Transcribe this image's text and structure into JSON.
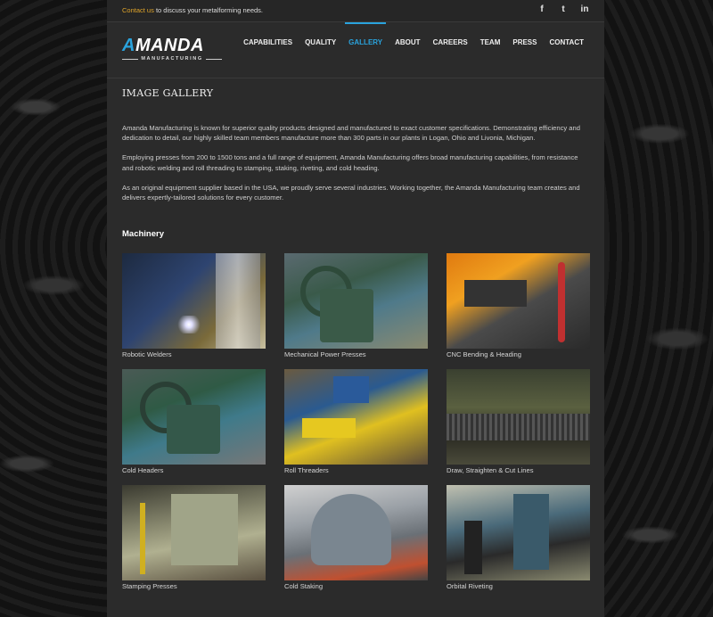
{
  "topbar": {
    "contact_link": "Contact us",
    "contact_rest": " to discuss your metalforming needs.",
    "social": [
      {
        "icon": "facebook-icon",
        "glyph": "f"
      },
      {
        "icon": "twitter-icon",
        "glyph": "t"
      },
      {
        "icon": "linkedin-icon",
        "glyph": "in"
      }
    ]
  },
  "logo": {
    "word_first": "A",
    "word_rest": "MANDA",
    "sub": "MANUFACTURING"
  },
  "nav": [
    "CAPABILITIES",
    "QUALITY",
    "GALLERY",
    "ABOUT",
    "CAREERS",
    "TEAM",
    "PRESS",
    "CONTACT"
  ],
  "nav_active": "GALLERY",
  "page": {
    "title": "IMAGE GALLERY",
    "paragraphs": [
      "Amanda Manufacturing is known for superior quality products designed and manufactured to exact customer specifications. Demonstrating efficiency and dedication to detail, our highly skilled team members manufacture more than 300 parts in our plants in Logan, Ohio and Livonia, Michigan.",
      "Employing presses from 200 to 1500 tons and a full range of equipment, Amanda Manufacturing offers broad manufacturing capabilities, from resistance and robotic welding and roll threading to stamping, staking, riveting, and cold heading.",
      "As an original equipment supplier based in the USA, we proudly serve several industries. Working together, the Amanda Manufacturing team creates and delivers expertly-tailored solutions for every customer."
    ],
    "section": "Machinery",
    "gallery": [
      "Robotic Welders",
      "Mechanical Power Presses",
      "CNC Bending & Heading",
      "Cold Headers",
      "Roll Threaders",
      "Draw, Straighten & Cut Lines",
      "Stamping Presses",
      "Cold Staking",
      "Orbital Riveting"
    ]
  },
  "colors": {
    "accent": "#2aa3dd",
    "contact_link": "#e0a52a",
    "panel": "#2b2b2b"
  }
}
